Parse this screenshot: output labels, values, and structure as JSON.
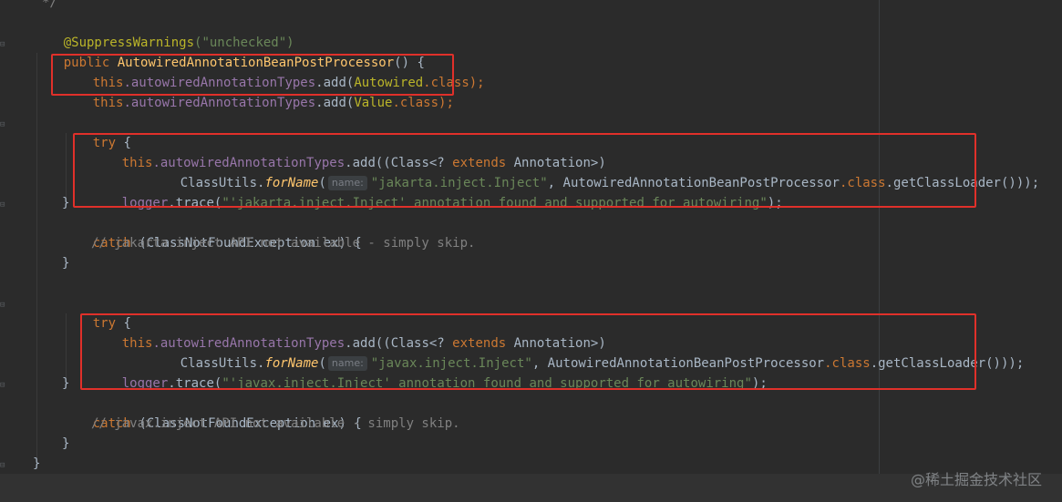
{
  "lines": {
    "l0": "*/",
    "l1_ann": "@SuppressWarnings",
    "l1_str": "(\"unchecked\")",
    "l2_kw": "public ",
    "l2_name": "AutowiredAnnotationBeanPostProcessor",
    "l2_rest": "() {",
    "l3_this": "this",
    "l3_field": ".autowiredAnnotationTypes",
    "l3_add": ".add(",
    "l3_cls": "Autowired",
    "l3_kwcls": ".class",
    "l3_end": ");",
    "l4_this": "this",
    "l4_field": ".autowiredAnnotationTypes",
    "l4_add": ".add(",
    "l4_cls": "Value",
    "l4_kwcls": ".class",
    "l4_end": ");",
    "try1": "try",
    "brace_open": " {",
    "a_this": "this",
    "a_field": ".autowiredAnnotationTypes",
    "a_add": ".add((Class<? ",
    "a_extends": "extends",
    "a_ann": " Annotation>)",
    "b_utils": "ClassUtils.",
    "b_forname": "forName",
    "b_paren": "(",
    "hint_name": "name:",
    "b_str1": "\"jakarta.inject.Inject\"",
    "b_mid": ", AutowiredAnnotationBeanPostProcessor",
    "b_class": ".class",
    "b_end": ".getClassLoader()));",
    "c_logger": "logger",
    "c_trace": ".trace(",
    "c_str1": "\"'jakarta.inject.Inject' annotation found and supported for autowiring\"",
    "c_end": ");",
    "close": "}",
    "catch_kw": "catch",
    "catch_rest": " (ClassNotFoundException ex) {",
    "cmt1": "// jakarta.inject API not available - simply skip.",
    "try2": "try",
    "b_str2": "\"javax.inject.Inject\"",
    "c_str2": "\"'javax.inject.Inject' annotation found and supported for autowiring\"",
    "cmt2": "// javax.inject API not available - simply skip."
  },
  "watermark": "@稀土掘金技术社区",
  "colors": {
    "background": "#2b2b2b",
    "keyword": "#cc7832",
    "annotation": "#bbb529",
    "method": "#ffc66d",
    "field": "#9876aa",
    "string": "#6a8759",
    "comment": "#808080",
    "highlight_box": "#e0302a"
  }
}
